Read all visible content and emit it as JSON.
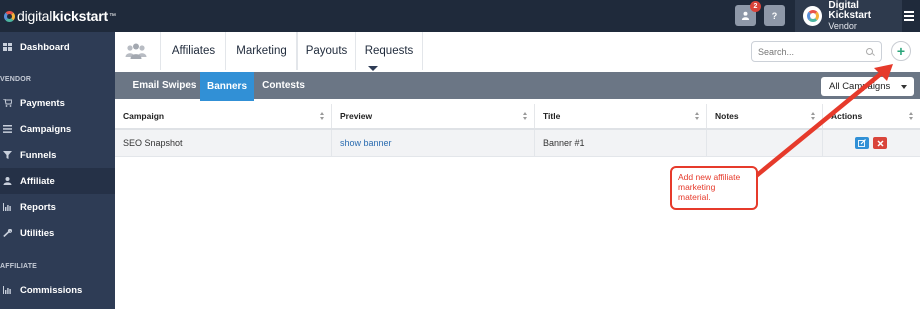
{
  "topbar": {
    "logo_light": "digital",
    "logo_bold": "kickstart",
    "logo_tm": "™",
    "notification_count": "2",
    "help_label": "?",
    "user_name": "Digital Kickstart",
    "user_role": "Vendor"
  },
  "sidebar": {
    "items": [
      {
        "label": "Dashboard",
        "icon": "dashboard-icon"
      },
      {
        "label": "Payments",
        "icon": "cart-icon"
      },
      {
        "label": "Campaigns",
        "icon": "list-icon"
      },
      {
        "label": "Funnels",
        "icon": "funnel-icon"
      },
      {
        "label": "Affiliate",
        "icon": "user-icon"
      },
      {
        "label": "Reports",
        "icon": "bar-chart-icon"
      },
      {
        "label": "Utilities",
        "icon": "wrench-icon"
      },
      {
        "label": "Commissions",
        "icon": "bar-chart-icon"
      }
    ],
    "sections": [
      "VENDOR",
      "AFFILIATE"
    ],
    "active": "Affiliate"
  },
  "tabs": {
    "items": [
      "Affiliates",
      "Marketing",
      "Payouts",
      "Requests"
    ],
    "active": "Marketing"
  },
  "search": {
    "placeholder": "Search..."
  },
  "add_button": {
    "label": "+"
  },
  "subtabs": {
    "items": [
      "Email Swipes",
      "Banners",
      "Contests"
    ],
    "active": "Banners"
  },
  "campaign_filter": {
    "selected": "All Campaigns"
  },
  "table": {
    "columns": [
      "Campaign",
      "Preview",
      "Title",
      "Notes",
      "Actions"
    ],
    "rows": [
      {
        "campaign": "SEO Snapshot",
        "preview": "show banner",
        "title": "Banner #1",
        "notes": ""
      }
    ]
  },
  "annotation": {
    "text": "Add new affiliate marketing material."
  },
  "colors": {
    "topbar": "#1f2a3b",
    "sidebar": "#2e3c55",
    "subnav": "#6b7685",
    "accent": "#3190d6",
    "danger": "#d9443a",
    "annotation": "#e63a2b"
  }
}
